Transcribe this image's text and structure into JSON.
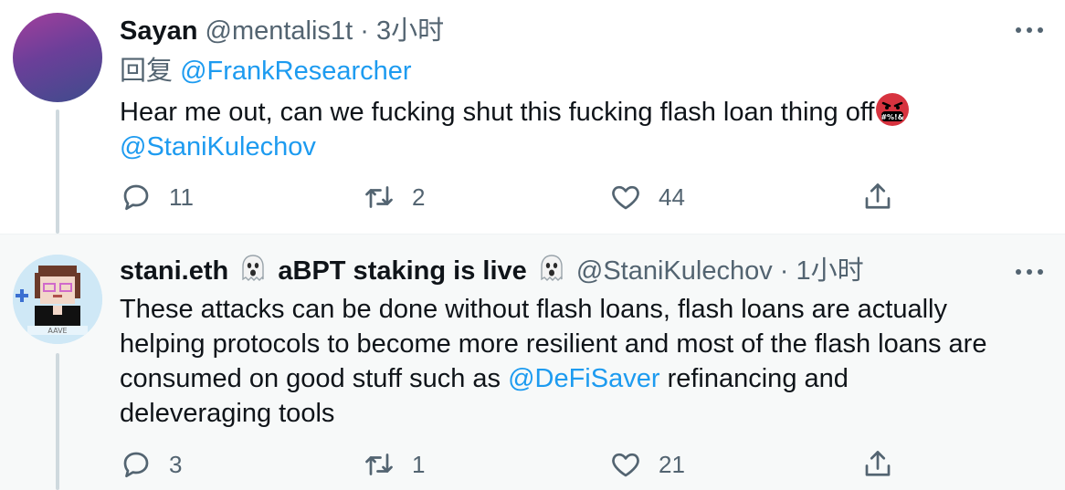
{
  "tweets": [
    {
      "name": "Sayan",
      "handle": "@mentalis1t",
      "separator": "·",
      "time": "3小时",
      "reply_prefix": "回复",
      "reply_to": "@FrankResearcher",
      "text_line1": "Hear me out, can we fucking shut this fucking flash loan thing off",
      "emoji_label": "#%!&",
      "mention": "@StaniKulechov",
      "counts": {
        "replies": "11",
        "retweets": "2",
        "likes": "44"
      }
    },
    {
      "name": "stani.eth",
      "name_suffix": "aBPT staking is live",
      "handle": "@StaniKulechov",
      "separator": "·",
      "time": "1小时",
      "text_line1": "These attacks can be done without flash loans, flash loans are actually",
      "text_line2": "helping protocols to become more resilient and most of the flash loans are",
      "text_line3_pre": "consumed on good stuff such as ",
      "text_line3_link": "@DeFiSaver",
      "text_line3_post": " refinancing and",
      "text_line4": "deleveraging tools",
      "avatar_text": "AAVE",
      "counts": {
        "replies": "3",
        "retweets": "1",
        "likes": "21"
      }
    }
  ],
  "icons": [
    "more-icon",
    "reply-icon",
    "retweet-icon",
    "like-icon",
    "share-icon",
    "ghost-emoji-icon",
    "angry-emoji-icon"
  ],
  "colors": {
    "link": "#1d9bf0",
    "secondary": "#536471",
    "thread_line": "#cfd9de",
    "highlight_bg": "#f7f9f9"
  }
}
